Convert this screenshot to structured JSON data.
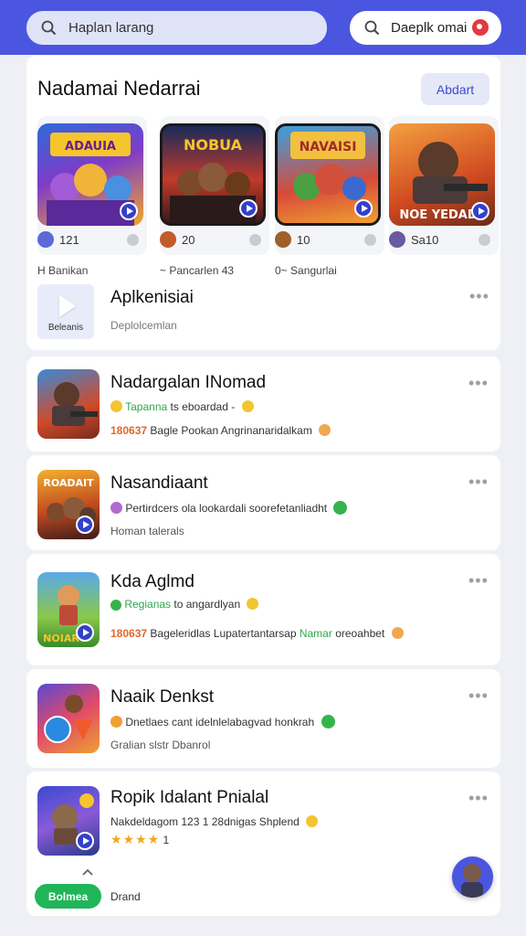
{
  "header": {
    "search_placeholder": "Haplan larang",
    "pill_label": "Daeplk omai"
  },
  "featured": {
    "title": "Nadamai Nedarrai",
    "about_label": "Abdart",
    "tiles": [
      {
        "count": "121",
        "art": "ADAUIA PRAIAS"
      },
      {
        "count": "20",
        "art": "NOBUA"
      },
      {
        "count": "10",
        "art": "NAVAISI"
      },
      {
        "count": "Sa10",
        "art": "NOE YEDAD"
      }
    ],
    "captions": [
      "Banikan",
      "Pancarlen",
      "Sangurlai"
    ],
    "caption_prefixes": [
      "H",
      "~",
      "0~"
    ],
    "caption_suffix_2": "43",
    "apk": {
      "title": "Aplkenisiai",
      "subtitle": "Deplolcemlan",
      "icon_label": "Beleanis"
    }
  },
  "list": [
    {
      "title": "Nadargalan INomad",
      "tag": "Tapanna",
      "tag_rest": "ts eboardad -",
      "code": "180637",
      "desc": "Bagle Pookan Angrinanaridalkam"
    },
    {
      "title": "Nasandiaant",
      "line1": "Pertirdcers ola lookardali soorefetanliadht",
      "line2": "Homan talerals"
    },
    {
      "title": "Kda Aglmd",
      "tag": "Regianas",
      "tag_rest": "to angardlyan",
      "code": "180637",
      "desc": "Bageleridlas Lupatertantarsap",
      "green_word": "Namar",
      "desc_end": "oreoahbet"
    },
    {
      "title": "Naaik Denkst",
      "line1": "Dnetlaes cant idelnlelabagvad honkrah",
      "line2": "Gralian slstr Dbanrol"
    },
    {
      "title": "Ropik Idalant Pnialal",
      "line1": "Nakdeldagom 123 1 28dnigas Shplend",
      "rating": "★★★★",
      "rating_num": "1"
    }
  ],
  "bottom": {
    "button_label": "Bolmea",
    "text": "Drand"
  },
  "colors": {
    "brand": "#4a56e0",
    "accent_green": "#21b55a",
    "accent_orange": "#e0682a"
  }
}
